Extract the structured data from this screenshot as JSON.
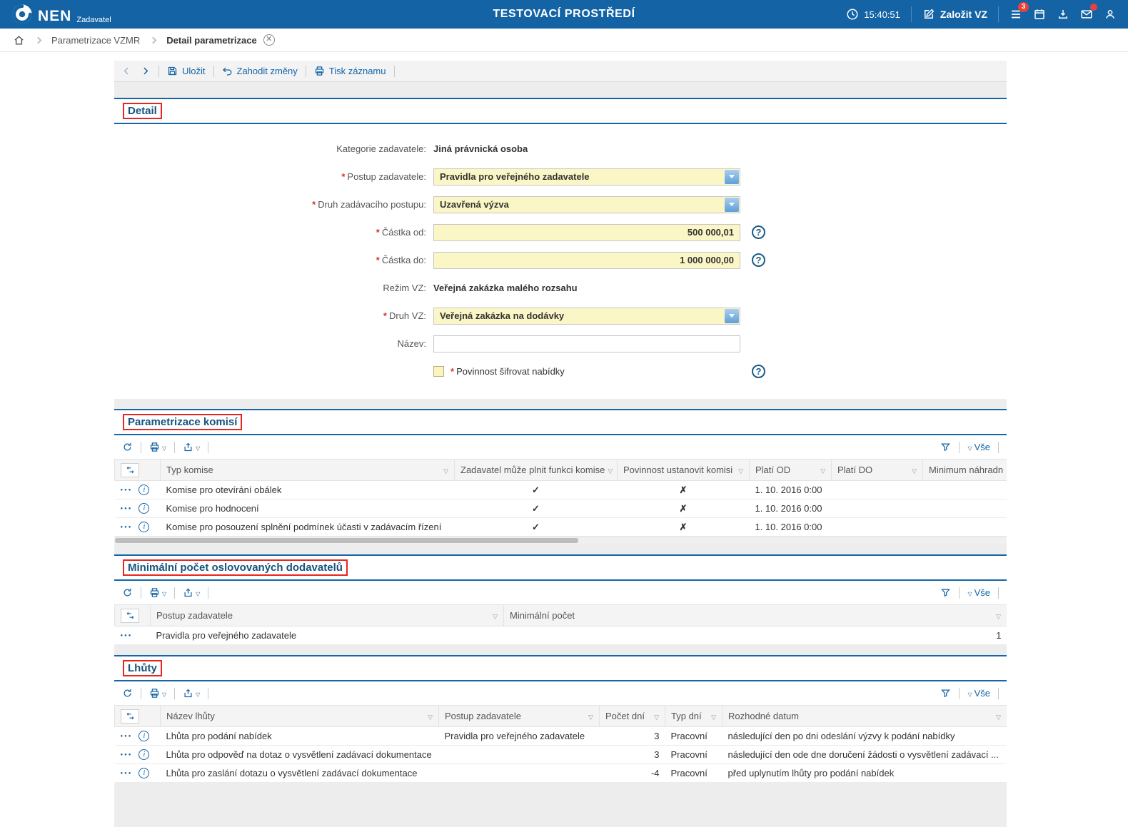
{
  "icons": {
    "check": "✓",
    "cross": "✗"
  },
  "topbar": {
    "brand": "NEN",
    "brand_sub": "Zadavatel",
    "title": "TESTOVACÍ PROSTŘEDÍ",
    "time": "15:40:51",
    "new_vz": "Založit VZ",
    "menu_badge": "3"
  },
  "breadcrumb": {
    "parent": "Parametrizace VZMR",
    "current": "Detail parametrizace"
  },
  "toolbar": {
    "save": "Uložit",
    "discard": "Zahodit změny",
    "print": "Tisk záznamu"
  },
  "grid_toolbar": {
    "vse": "Vše"
  },
  "detail": {
    "title": "Detail",
    "kategorie_label": "Kategorie zadavatele:",
    "kategorie_value": "Jiná právnická osoba",
    "postup_label": "Postup zadavatele:",
    "postup_value": "Pravidla pro veřejného zadavatele",
    "druh_postupu_label": "Druh zadávacího postupu:",
    "druh_postupu_value": "Uzavřená výzva",
    "castka_od_label": "Částka od:",
    "castka_od_value": "500 000,01",
    "castka_do_label": "Částka do:",
    "castka_do_value": "1 000 000,00",
    "rezim_label": "Režim VZ:",
    "rezim_value": "Veřejná zakázka malého rozsahu",
    "druh_vz_label": "Druh VZ:",
    "druh_vz_value": "Veřejná zakázka na dodávky",
    "nazev_label": "Název:",
    "nazev_value": "",
    "sifrovat_label": "Povinnost šifrovat nabídky"
  },
  "komise": {
    "title": "Parametrizace komisí",
    "headers": [
      "Typ komise",
      "Zadavatel může plnit funkci komise",
      "Povinnost ustanovit komisi",
      "Platí OD",
      "Platí DO",
      "Minimum náhradn"
    ],
    "rows": [
      {
        "name": "Komise pro otevírání obálek",
        "plati_od": "1. 10. 2016 0:00",
        "plati_do": "",
        "minimum": ""
      },
      {
        "name": "Komise pro hodnocení",
        "plati_od": "1. 10. 2016 0:00",
        "plati_do": "",
        "minimum": ""
      },
      {
        "name": "Komise pro posouzení splnění podmínek účasti v zadávacím řízení",
        "plati_od": "1. 10. 2016 0:00",
        "plati_do": "",
        "minimum": ""
      }
    ]
  },
  "dodavatele": {
    "title": "Minimální počet oslovovaných dodavatelů",
    "headers": [
      "Postup zadavatele",
      "Minimální počet"
    ],
    "rows": [
      {
        "postup": "Pravidla pro veřejného zadavatele",
        "pocet": "1"
      }
    ]
  },
  "lhuty": {
    "title": "Lhůty",
    "headers": [
      "Název lhůty",
      "Postup zadavatele",
      "Počet dní",
      "Typ dní",
      "Rozhodné datum"
    ],
    "rows": [
      {
        "nazev": "Lhůta pro podání nabídek",
        "postup": "Pravidla pro veřejného zadavatele",
        "pocet": "3",
        "typ": "Pracovní",
        "datum": "následující den po dni odeslání výzvy k podání nabídky"
      },
      {
        "nazev": "Lhůta pro odpověď na dotaz o vysvětlení zadávací dokumentace",
        "postup": "",
        "pocet": "3",
        "typ": "Pracovní",
        "datum": "následující den ode dne doručení žádosti o vysvětlení zadávací ..."
      },
      {
        "nazev": "Lhůta pro zaslání dotazu o vysvětlení zadávací dokumentace",
        "postup": "",
        "pocet": "-4",
        "typ": "Pracovní",
        "datum": "před uplynutím lhůty pro podání nabídek"
      }
    ]
  }
}
